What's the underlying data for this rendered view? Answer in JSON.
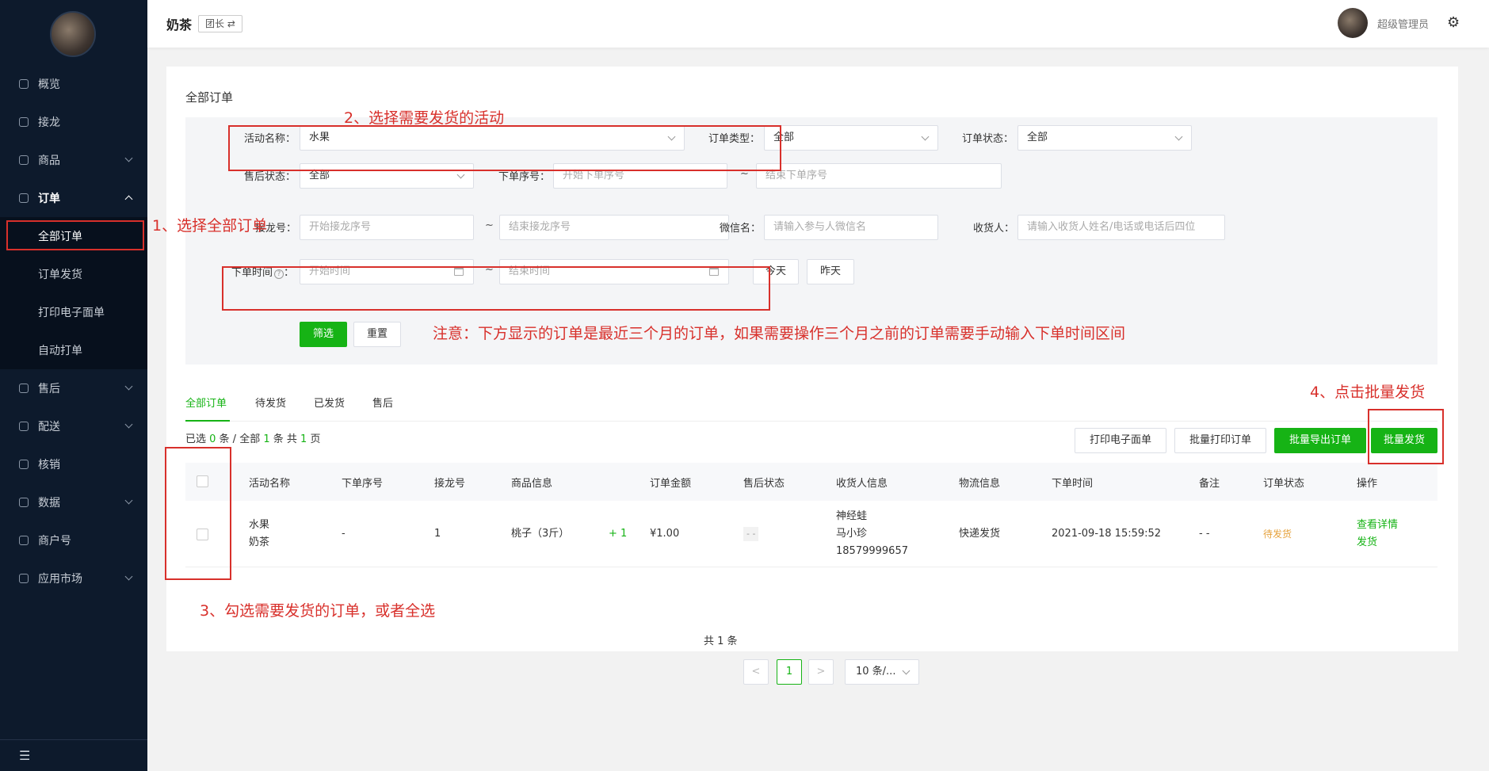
{
  "app": {
    "title": "奶茶",
    "role": "团长 ⇄",
    "user": "超级管理员"
  },
  "sidebar": {
    "items": [
      {
        "label": "概览"
      },
      {
        "label": "接龙"
      },
      {
        "label": "商品"
      },
      {
        "label": "订单"
      },
      {
        "label": "售后"
      },
      {
        "label": "配送"
      },
      {
        "label": "核销"
      },
      {
        "label": "数据"
      },
      {
        "label": "商户号"
      },
      {
        "label": "应用市场"
      }
    ],
    "order_sub": [
      {
        "label": "全部订单"
      },
      {
        "label": "订单发货"
      },
      {
        "label": "打印电子面单"
      },
      {
        "label": "自动打单"
      }
    ],
    "collapse": "☰"
  },
  "page": {
    "title": "全部订单"
  },
  "filter": {
    "activity_label": "活动名称：",
    "activity_value": "水果",
    "order_type_label": "订单类型：",
    "order_type_value": "全部",
    "order_status_label": "订单状态：",
    "order_status_value": "全部",
    "after_sale_label": "售后状态：",
    "after_sale_value": "全部",
    "seq_label": "下单序号：",
    "seq_start_ph": "开始下单序号",
    "seq_end_ph": "结束下单序号",
    "jielong_label": "接龙号：",
    "jielong_start_ph": "开始接龙序号",
    "jielong_end_ph": "结束接龙序号",
    "wechat_label": "微信名：",
    "wechat_ph": "请输入参与人微信名",
    "receiver_label": "收货人：",
    "receiver_ph": "请输入收货人姓名/电话或电话后四位",
    "time_label": "下单时间",
    "time_help": "?",
    "time_start_ph": "开始时间",
    "time_end_ph": "结束时间",
    "tilde": "~",
    "today": "今天",
    "yesterday": "昨天",
    "search": "筛选",
    "reset": "重置"
  },
  "tabs": [
    "全部订单",
    "待发货",
    "已发货",
    "售后"
  ],
  "summary": {
    "p1": "已选 ",
    "selected": "0",
    "p2": " 条 / 全部 ",
    "total": "1",
    "p3": " 条 共 ",
    "pages": "1",
    "p4": " 页"
  },
  "actions": {
    "print_label": "打印电子面单",
    "batch_print": "批量打印订单",
    "batch_export": "批量导出订单",
    "batch_ship": "批量发货"
  },
  "table": {
    "columns": [
      "活动名称",
      "下单序号",
      "接龙号",
      "商品信息",
      "订单金额",
      "售后状态",
      "收货人信息",
      "物流信息",
      "下单时间",
      "备注",
      "订单状态",
      "操作"
    ],
    "row": {
      "activity": "水果",
      "shop": "奶茶",
      "seq": "-",
      "jielong": "1",
      "product": "桃子（3斤）",
      "qty": "+ 1",
      "amount": "¥1.00",
      "after_sale": "- -",
      "receiver_nick": "神经蛙",
      "receiver_name": "马小珍",
      "receiver_phone": "18579999657",
      "logistics": "快递发货",
      "time": "2021-09-18 15:59:52",
      "remark": "- -",
      "status": "待发货",
      "op_detail": "查看详情",
      "op_ship": "发货"
    }
  },
  "pagination": {
    "total": "共 1 条",
    "prev": "<",
    "current": "1",
    "next": ">",
    "size": "10 条/..."
  },
  "annotations": {
    "a1": "1、选择全部订单",
    "a2": "2、选择需要发货的活动",
    "a3": "3、勾选需要发货的订单，或者全选",
    "a4": "4、点击批量发货",
    "note": "注意：下方显示的订单是最近三个月的订单，如果需要操作三个月之前的订单需要手动输入下单时间区间"
  },
  "colors": {
    "sidebar_bg": "#0d1a2c",
    "accent_green": "#16b315",
    "annotation_red": "#d8302b",
    "pending_orange": "#e6a23c"
  }
}
